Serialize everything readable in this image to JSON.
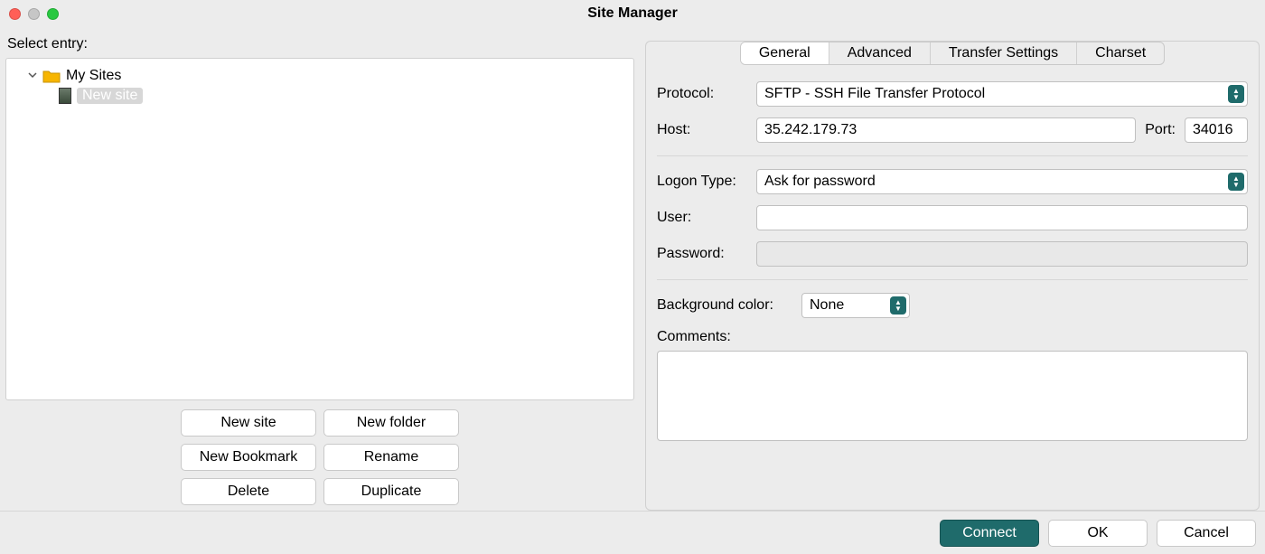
{
  "window": {
    "title": "Site Manager"
  },
  "left": {
    "select_label": "Select entry:",
    "tree": {
      "root_label": "My Sites",
      "selected_item": "New site"
    },
    "buttons": {
      "new_site": "New site",
      "new_folder": "New folder",
      "new_bookmark": "New Bookmark",
      "rename": "Rename",
      "delete": "Delete",
      "duplicate": "Duplicate"
    }
  },
  "tabs": {
    "general": "General",
    "advanced": "Advanced",
    "transfer": "Transfer Settings",
    "charset": "Charset"
  },
  "form": {
    "protocol_label": "Protocol:",
    "protocol_value": "SFTP - SSH File Transfer Protocol",
    "host_label": "Host:",
    "host_value": "35.242.179.73",
    "port_label": "Port:",
    "port_value": "34016",
    "logon_label": "Logon Type:",
    "logon_value": "Ask for password",
    "user_label": "User:",
    "user_value": "",
    "password_label": "Password:",
    "password_value": "",
    "bgcolor_label": "Background color:",
    "bgcolor_value": "None",
    "comments_label": "Comments:",
    "comments_value": ""
  },
  "footer": {
    "connect": "Connect",
    "ok": "OK",
    "cancel": "Cancel"
  }
}
